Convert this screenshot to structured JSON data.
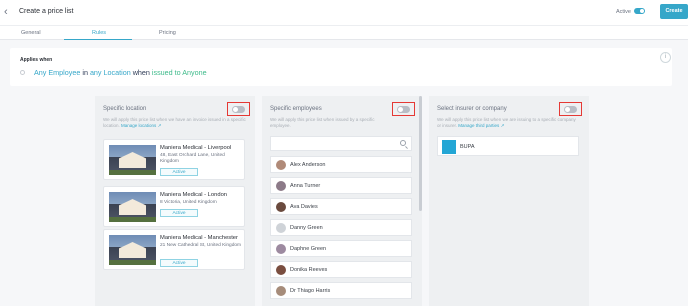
{
  "header": {
    "title": "Create a price list",
    "active_label": "Active",
    "create_label": "Create"
  },
  "tabs": [
    {
      "label": "General"
    },
    {
      "label": "Rules"
    },
    {
      "label": "Pricing"
    }
  ],
  "applies": {
    "title": "Applies when",
    "rule": {
      "employee": "Any Employee",
      "in": " in ",
      "location": "any Location",
      "when": " when ",
      "issued": "issued to Anyone"
    }
  },
  "location": {
    "heading": "Specific location",
    "desc": "We will apply this price list when we have an invoice issued in a specific location.",
    "manage": "Manage locations",
    "cards": [
      {
        "name": "Maniera Medical - Liverpool",
        "address": "48, East Orchard Lane, United Kingdom",
        "status": "Active"
      },
      {
        "name": "Maniera Medical - London",
        "address": "8 Victoria, United Kingdom",
        "status": "Active"
      },
      {
        "name": "Maniera Medical - Manchester",
        "address": "21 New Cathedral St, United Kingdom",
        "status": "Active"
      }
    ]
  },
  "employees": {
    "heading": "Specific employees",
    "desc": "We will apply this price list when issued by a specific employee.",
    "list": [
      {
        "name": "Alex Anderson",
        "avatar_color": "#b08a78"
      },
      {
        "name": "Anna Turner",
        "avatar_color": "#8c7a88"
      },
      {
        "name": "Ava Davies",
        "avatar_color": "#6a4a3e"
      },
      {
        "name": "Danny Green",
        "avatar_color": "#cfd3d8"
      },
      {
        "name": "Daphne Green",
        "avatar_color": "#9d8aa0"
      },
      {
        "name": "Donika Reeves",
        "avatar_color": "#7a4e40"
      },
      {
        "name": "Dr Thiago Harris",
        "avatar_color": "#a68c7a"
      }
    ]
  },
  "insurer": {
    "heading": "Select insurer or company",
    "desc": "We will apply this price list when we are issuing to a specific company or insurer.",
    "manage": "Manage third parties",
    "items": [
      {
        "name": "BUPA"
      }
    ]
  },
  "colors": {
    "accent": "#36a7c9",
    "highlight": "#e53935"
  }
}
